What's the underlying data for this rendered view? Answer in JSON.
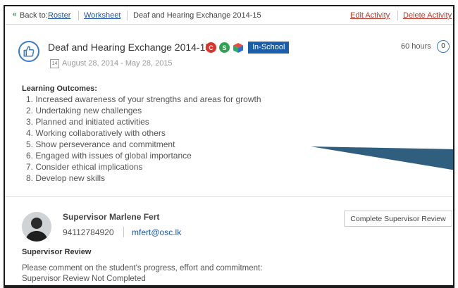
{
  "topbar": {
    "back_icon": "back-arrows-icon",
    "back_label": "Back to:",
    "roster_link": "Roster",
    "worksheet_link": "Worksheet",
    "breadcrumb_current": "Deaf and Hearing Exchange 2014-15",
    "edit_label": "Edit Activity",
    "delete_label": "Delete Activity"
  },
  "activity": {
    "icon": "thumbs-up-icon",
    "title": "Deaf and Hearing Exchange 2014-15",
    "badges": [
      {
        "label": "C",
        "color": "#d9342b"
      },
      {
        "label": "S",
        "color": "#2ea24f"
      }
    ],
    "type_tag": "In-School",
    "calendar_day": "14",
    "dates": "August 28, 2014 - May 28, 2015",
    "hours_label": "60 hours",
    "hours_count": "0"
  },
  "outcomes": {
    "heading": "Learning Outcomes:",
    "items": [
      "1.  Increased awareness of your strengths and areas for growth",
      "2.  Undertaking new challenges",
      "3.  Planned and initiated activities",
      "4.  Working collaboratively with others",
      "5.  Show perseverance and commitment",
      "6.  Engaged with issues of global importance",
      "7.  Consider ethical implications",
      "8.  Develop new skills"
    ]
  },
  "supervisor": {
    "name": "Supervisor Marlene Fert",
    "phone": "94112784920",
    "email": "mfert@osc.lk",
    "review_button": "Complete Supervisor Review",
    "review_heading": "Supervisor Review",
    "review_prompt": "Please comment on the student's progress, effort and commitment:",
    "review_status": "Supervisor Review Not Completed"
  },
  "colors": {
    "accent_blue": "#1b5fab",
    "link_blue": "#1a55a8",
    "danger_red": "#c0392b"
  }
}
